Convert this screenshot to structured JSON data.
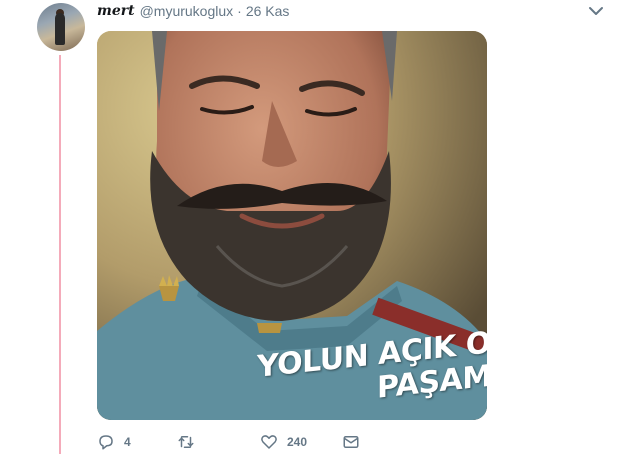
{
  "tweet": {
    "author_name": "mert",
    "handle": "@myurukoglux",
    "separator": "·",
    "timestamp": "26 Kas",
    "media": {
      "caption_line1": "YOLUN AÇIK OLSUN",
      "caption_line2": "PAŞAM!"
    },
    "actions": {
      "reply_count": "4",
      "retweet_count": "",
      "like_count": "240"
    }
  },
  "colors": {
    "thread_line": "#f4abba",
    "muted_text": "#657786",
    "uniform_blue": "#5f8f9e"
  },
  "icons": [
    "avatar",
    "chevron-down-icon",
    "reply-icon",
    "retweet-icon",
    "heart-icon",
    "envelope-icon"
  ]
}
